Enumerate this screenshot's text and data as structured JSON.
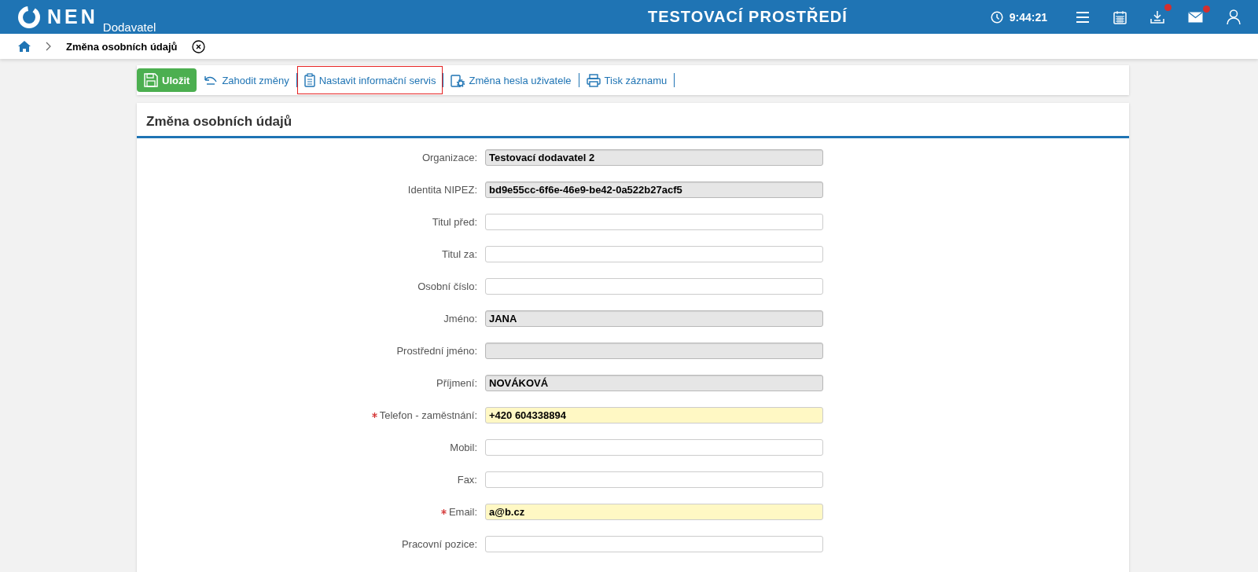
{
  "header": {
    "logo": "NEN",
    "subtitle": "Dodavatel",
    "environment": "TESTOVACÍ PROSTŘEDÍ",
    "time": "9:44:21",
    "icons": [
      {
        "kind": "menu"
      },
      {
        "kind": "calendar"
      },
      {
        "kind": "download",
        "badge": true
      },
      {
        "kind": "mail",
        "badge": true
      },
      {
        "kind": "user"
      }
    ]
  },
  "breadcrumb": {
    "title": "Změna osobních údajů"
  },
  "toolbar": [
    {
      "kind": "save",
      "label": "Uložit",
      "highlighted": false
    },
    {
      "kind": "discard",
      "label": "Zahodit změny",
      "highlighted": false
    },
    {
      "kind": "clipboard",
      "label": "Nastavit informační servis",
      "highlighted": true
    },
    {
      "kind": "password",
      "label": "Změna hesla uživatele",
      "highlighted": false
    },
    {
      "kind": "print",
      "label": "Tisk záznamu",
      "highlighted": false
    }
  ],
  "form": {
    "title": "Změna osobních údajů",
    "fields": [
      {
        "label": "Organizace:",
        "value": "Testovací dodavatel 2",
        "readonly": true,
        "required": false
      },
      {
        "label": "Identita NIPEZ:",
        "value": "bd9e55cc-6f6e-46e9-be42-0a522b27acf5",
        "readonly": true,
        "required": false
      },
      {
        "label": "Titul před:",
        "readonly": false,
        "required": false
      },
      {
        "label": "Titul za:",
        "readonly": false,
        "required": false
      },
      {
        "label": "Osobní číslo:",
        "readonly": false,
        "required": false
      },
      {
        "label": "Jméno:",
        "value": "JANA",
        "readonly": true,
        "required": false
      },
      {
        "label": "Prostřední jméno:",
        "readonly": true,
        "required": false
      },
      {
        "label": "Příjmení:",
        "value": "NOVÁKOVÁ",
        "readonly": true,
        "required": false
      },
      {
        "label": "Telefon - zaměstnání:",
        "value": "+420 604338894",
        "readonly": false,
        "required": true
      },
      {
        "label": "Mobil:",
        "readonly": false,
        "required": false
      },
      {
        "label": "Fax:",
        "readonly": false,
        "required": false
      },
      {
        "label": "Email:",
        "value": "a@b.cz",
        "readonly": false,
        "required": true
      },
      {
        "label": "Pracovní pozice:",
        "readonly": false,
        "required": false
      }
    ]
  }
}
